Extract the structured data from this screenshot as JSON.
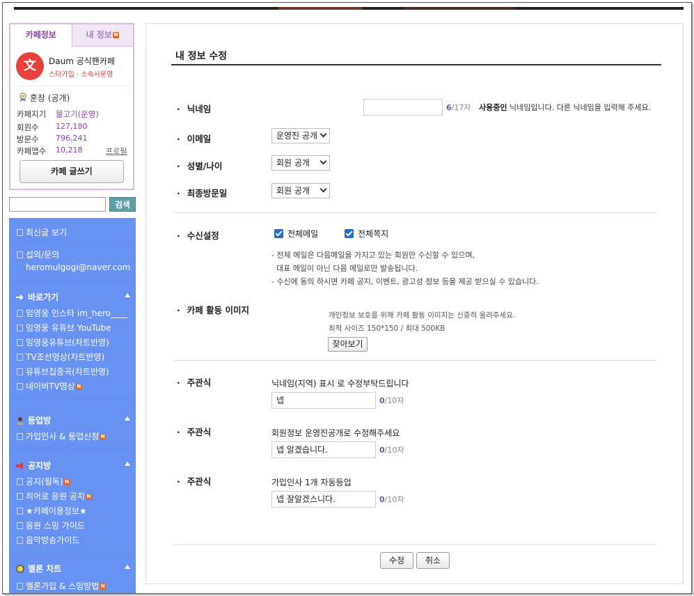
{
  "sidebar": {
    "tabs": {
      "cafe_info": "카페정보",
      "my_info": "내 정보"
    },
    "new_badge": "N",
    "cafe": {
      "logo_glyph": "文",
      "name": "Daum 공식팬카페",
      "sub": "스타가입 · 소속사운영"
    },
    "manager": "훈장 (공개)",
    "stats": [
      {
        "label": "카페지기",
        "value": "물고기(운영)"
      },
      {
        "label": "회원수",
        "value": "127,180"
      },
      {
        "label": "방문수",
        "value": "796,241"
      },
      {
        "label": "카페앱수",
        "value": "10,218"
      }
    ],
    "profile_link": "프로필",
    "write_button": "카페 글쓰기",
    "search_button": "검색",
    "menu": {
      "recent": "최신글 보기",
      "contact": "섭외/문의",
      "email": "heromulgogi@naver.com",
      "sections": [
        {
          "title": "바로가기",
          "items": [
            "임영웅 인스타 im_hero____",
            "임영웅 유튜브 YouTube",
            "임영웅유튜브(차트반영)",
            "TV조선영상(차트반영)",
            "유튜브집중곡(차트반영)",
            "네이버TV영상"
          ]
        },
        {
          "title": "등업방",
          "items": [
            "가입인사 & 등업신청"
          ]
        },
        {
          "title": "공지방",
          "items": [
            "공지(필독)",
            "히어로 응원 공지",
            "★카페이용정보★",
            "음원 스밍 가이드",
            "음악방송가이드"
          ]
        },
        {
          "title": "멜론 차트",
          "items": [
            "멜론가입 & 스밍방법"
          ]
        }
      ]
    }
  },
  "main": {
    "title": "내 정보 수정",
    "nickname": {
      "label": "닉네임",
      "count": "6",
      "max": "/17자",
      "msg_bold": "사용중인",
      "msg_rest": " 닉네임입니다. 다른 닉네임을 입력해 주세요."
    },
    "email": {
      "label": "이메일",
      "value": "운영진 공개"
    },
    "gender": {
      "label": "성별/나이",
      "value": "회원 공개"
    },
    "last_visit": {
      "label": "최종방문일",
      "value": "회원 공개"
    },
    "receive": {
      "label": "수신설정",
      "all_mail": "전체메일",
      "all_note": "전체쪽지",
      "notes": [
        "- 전체 메일은 다음메일을 가지고 있는 회원만 수신할 수 있으며,",
        "  대표 메일이 아닌 다음 메일로만 발송됩니다.",
        "- 수신에 동의 하시면 카페 공지, 이벤트, 광고성 정보 등을 제공 받으실 수 있습니다."
      ]
    },
    "image": {
      "label": "카페 활동 이미지",
      "note1": "개인정보 보호를 위해 카페 활동 이미지는 신중히 올려주세요.",
      "note2": "최적 사이즈 150*150 / 최대 500KB",
      "browse": "찾아보기"
    },
    "questions": [
      {
        "label": "주관식",
        "question": "닉네임(지역) 표시 로 수정부탁드립니다",
        "answer": "넵",
        "count": "0",
        "max": "/10자"
      },
      {
        "label": "주관식",
        "question": "회원정보 운영진공개로 수정해주세요",
        "answer": "넵 알겠습니다.",
        "count": "0",
        "max": "/10자"
      },
      {
        "label": "주관식",
        "question": "가입인사 1개 자동등업",
        "answer": "넵 잘알겠스니다.",
        "count": "0",
        "max": "/10자"
      }
    ],
    "submit": "수정",
    "cancel": "취소"
  }
}
